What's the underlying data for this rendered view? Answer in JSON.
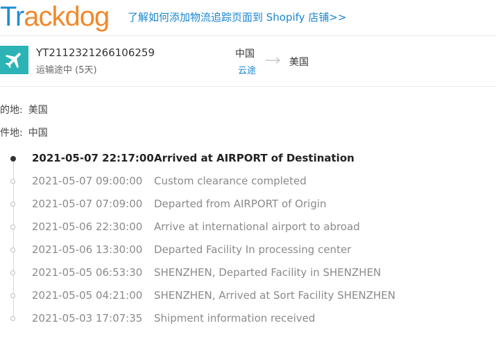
{
  "header": {
    "logo_part1": "Tr",
    "logo_part2": "ackdog",
    "shopify_link": "了解如何添加物流追踪页面到 Shopify 店铺>>"
  },
  "shipment": {
    "tracking_number": "YT2112321266106259",
    "status": "运输途中 (5天)",
    "origin": "中国",
    "carrier": "云途",
    "destination": "美国",
    "icon": "plane-icon",
    "accent_color": "#2cb3b5"
  },
  "info": {
    "destination_label": "目的地:",
    "destination_value": "美国",
    "origin_label": "发件地:",
    "origin_value": "中国"
  },
  "timeline": [
    {
      "time": "2021-05-07 22:17:00",
      "desc": "Arrived at AIRPORT of Destination"
    },
    {
      "time": "2021-05-07 09:00:00",
      "desc": "Custom clearance completed"
    },
    {
      "time": "2021-05-07 07:09:00",
      "desc": "Departed from AIRPORT of Origin"
    },
    {
      "time": "2021-05-06 22:30:00",
      "desc": "Arrive at international airport to abroad"
    },
    {
      "time": "2021-05-06 13:30:00",
      "desc": "Departed Facility In processing center"
    },
    {
      "time": "2021-05-05 06:53:30",
      "desc": "SHENZHEN, Departed Facility in SHENZHEN"
    },
    {
      "time": "2021-05-05 04:21:00",
      "desc": "SHENZHEN, Arrived at Sort Facility SHENZHEN"
    },
    {
      "time": "2021-05-03 17:07:35",
      "desc": "Shipment information received"
    }
  ]
}
